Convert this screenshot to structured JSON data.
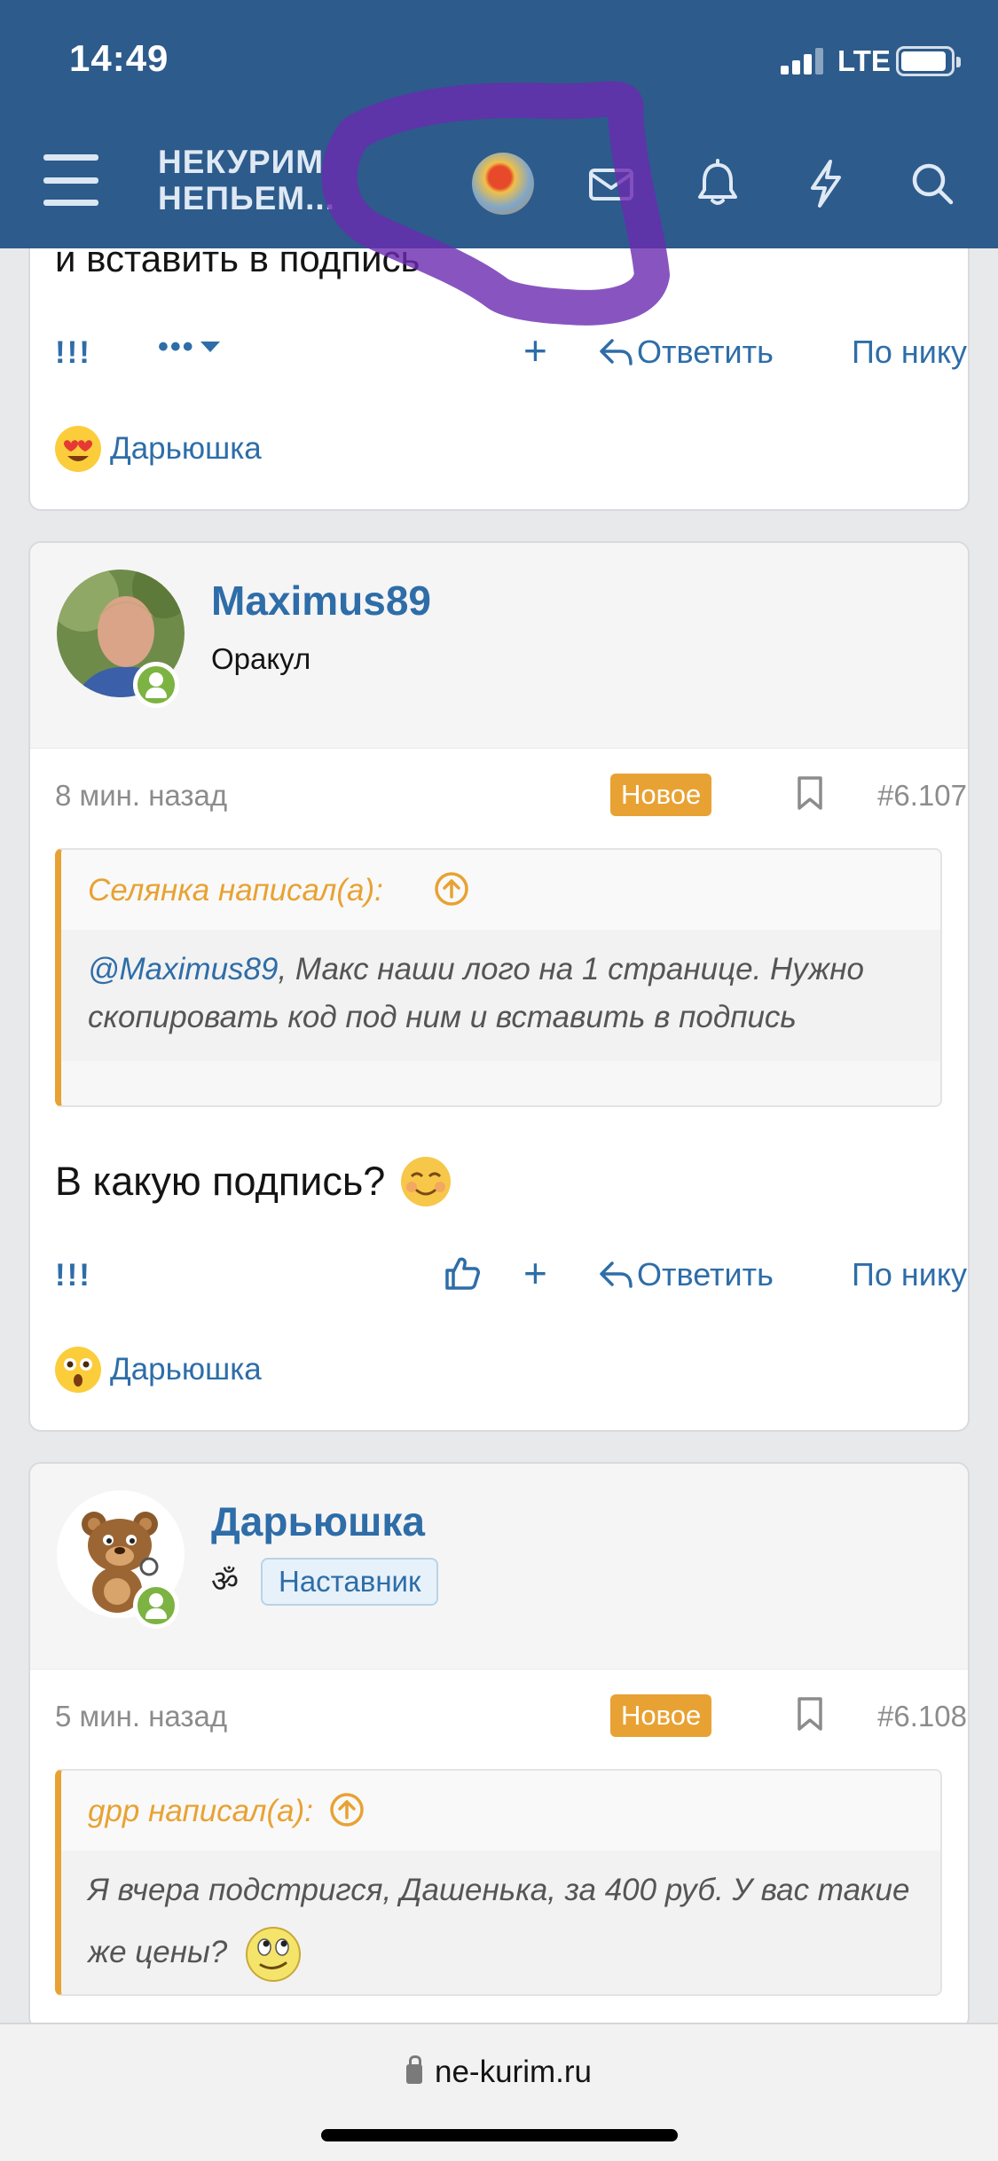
{
  "status_bar": {
    "time": "14:49",
    "network": "LTE"
  },
  "nav": {
    "logo_line1": "НЕКУРИМ",
    "logo_line2": "НЕПЬЕМ..."
  },
  "partial_post": {
    "text_tail": "и вставить в подпись",
    "actions": {
      "exclaim": "!!!",
      "plus": "+",
      "reply": "Ответить",
      "by_nick": "По нику"
    },
    "reaction_user": "Дарьюшка"
  },
  "posts": [
    {
      "username": "Maximus89",
      "user_title": "Оракул",
      "time": "8 мин. назад",
      "badge": "Новое",
      "post_number": "#6.107",
      "quote_author": "Селянка написал(а):",
      "quote_mention": "@Maximus89",
      "quote_text": ", Макс наши лого на 1 странице. Нужно скопировать код под ним и вставить в подпись",
      "text": "В какую подпись?",
      "actions": {
        "exclaim": "!!!",
        "plus": "+",
        "reply": "Ответить",
        "by_nick": "По нику"
      },
      "reaction_user": "Дарьюшка"
    },
    {
      "username": "Дарьюшка",
      "user_title": "Наставник",
      "user_symbol": "ॐ",
      "time": "5 мин. назад",
      "badge": "Новое",
      "post_number": "#6.108",
      "quote_author": "gpp написал(а):",
      "quote_text": "Я вчера подстригся, Дашенька, за 400 руб. У вас такие же цены?"
    }
  ],
  "browser": {
    "url": "ne-kurim.ru"
  },
  "colors": {
    "header": "#2d5b8c",
    "link": "#2e6da8",
    "accent": "#e8a233",
    "online": "#7cb342"
  }
}
